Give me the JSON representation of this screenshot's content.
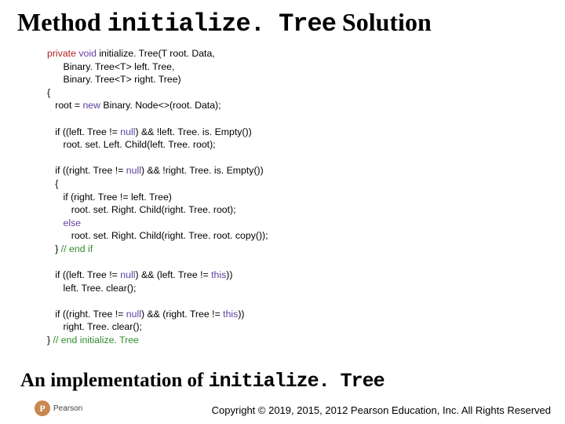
{
  "title": {
    "pre": "Method ",
    "mono": "initialize. Tree",
    "post": " Solution"
  },
  "code": {
    "l1": {
      "a": "private",
      "b": " ",
      "c": "void",
      "d": " initialize. Tree(T root. Data,"
    },
    "l2": "      Binary. Tree<T> left. Tree,",
    "l3": "      Binary. Tree<T> right. Tree)",
    "l4": "{",
    "l5": {
      "a": "   root = ",
      "b": "new",
      "c": " Binary. Node<>(root. Data);"
    },
    "l6": "",
    "l7": {
      "a": "   if ((left. Tree != ",
      "b": "null",
      "c": ") && !left. Tree. is. Empty())"
    },
    "l8": "      root. set. Left. Child(left. Tree. root);",
    "l9": "",
    "l10": {
      "a": "   if ((right. Tree != ",
      "b": "null",
      "c": ") && !right. Tree. is. Empty())"
    },
    "l11": "   {",
    "l12": "      if (right. Tree != left. Tree)",
    "l13": "         root. set. Right. Child(right. Tree. root);",
    "l14": {
      "a": "      ",
      "b": "else"
    },
    "l15": "         root. set. Right. Child(right. Tree. root. copy());",
    "l16": {
      "a": "   } ",
      "b": "// end if"
    },
    "l17": "",
    "l18": {
      "a": "   if ((left. Tree != ",
      "b": "null",
      "c": ") && (left. Tree != ",
      "d": "this",
      "e": "))"
    },
    "l19": "      left. Tree. clear();",
    "l20": "",
    "l21": {
      "a": "   if ((right. Tree != ",
      "b": "null",
      "c": ") && (right. Tree != ",
      "d": "this",
      "e": "))"
    },
    "l22": "      right. Tree. clear();",
    "l23": {
      "a": "} ",
      "b": "// end initialize. Tree"
    }
  },
  "caption": {
    "pre": "An implementation of ",
    "mono": "initialize. Tree"
  },
  "logo": {
    "letter": "P",
    "brand": "Pearson"
  },
  "footer": "Copyright © 2019, 2015, 2012 Pearson Education, Inc. All Rights Reserved"
}
